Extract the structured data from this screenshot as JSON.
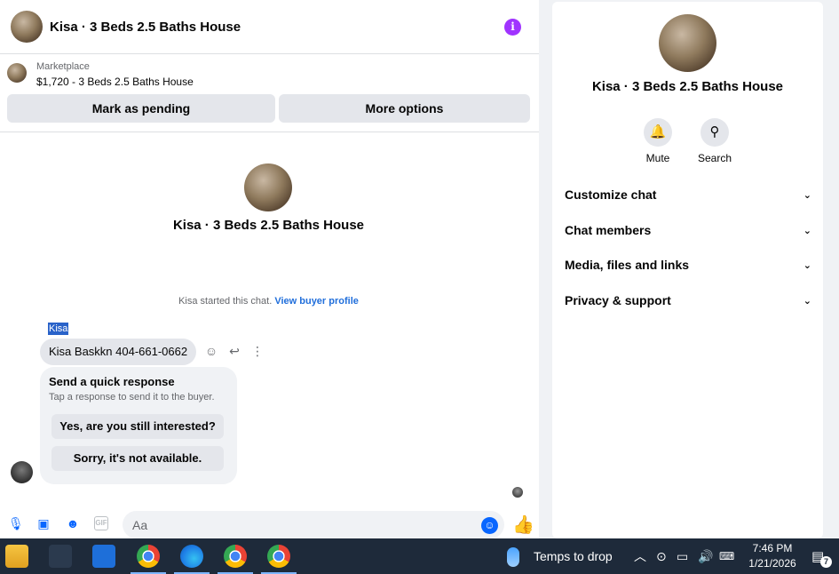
{
  "chat": {
    "header_title": "Kisa · 3 Beds 2.5 Baths House",
    "marketplace": {
      "label": "Marketplace",
      "item": "$1,720 - 3 Beds 2.5 Baths House",
      "pending_button": "Mark as pending",
      "more_button": "More options"
    },
    "intro": {
      "title": "Kisa · 3 Beds 2.5 Baths House",
      "started_text": "Kisa started this chat.",
      "profile_link": "View buyer profile"
    },
    "message": {
      "sender": "Kisa",
      "text": "Kisa Baskkn 404-661-0662"
    },
    "quick_response": {
      "title": "Send a quick response",
      "subtitle": "Tap a response to send it to the buyer.",
      "options": [
        "Yes, are you still interested?",
        "Sorry, it's not available."
      ]
    },
    "composer": {
      "placeholder": "Aa",
      "gif_label": "GIF"
    }
  },
  "info_panel": {
    "title": "Kisa · 3 Beds 2.5 Baths House",
    "actions": [
      {
        "label": "Mute",
        "icon": "bell-icon"
      },
      {
        "label": "Search",
        "icon": "search-icon"
      }
    ],
    "sections": [
      "Customize chat",
      "Chat members",
      "Media, files and links",
      "Privacy & support"
    ]
  },
  "taskbar": {
    "weather": "Temps to drop",
    "time": "7:46 PM",
    "date": "1/21/2026",
    "notification_count": "7"
  },
  "colors": {
    "accent": "#0866ff",
    "info": "#a033ff",
    "link": "#216fdb",
    "taskbar": "#1e2a3a"
  }
}
